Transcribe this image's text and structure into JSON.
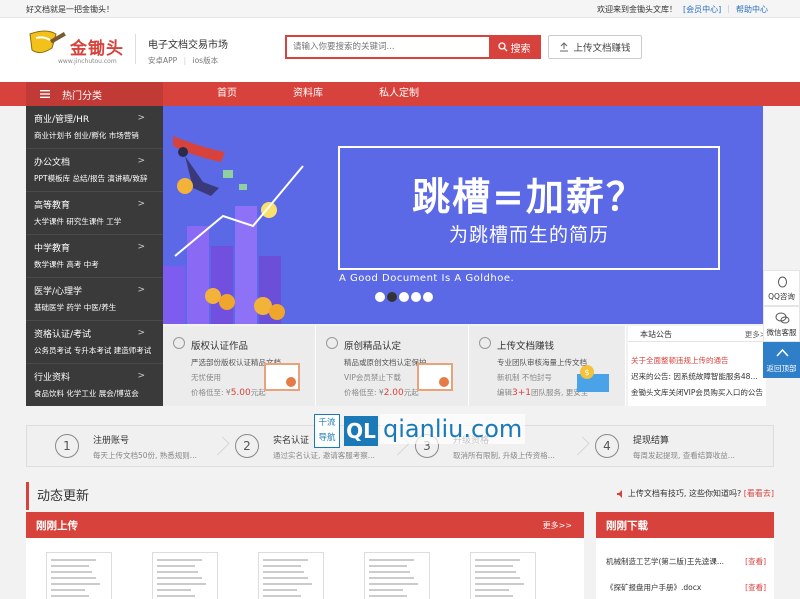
{
  "topbar": {
    "slogan": "好文档就是一把金锄头！",
    "welcome": "欢迎来到金锄头文库！",
    "member_center": "[会员中心]",
    "help_center": "帮助中心"
  },
  "header": {
    "logo_text": "金锄头",
    "logo_url": "www.jinchutou.com",
    "slogan": "电子文档交易市场",
    "apps": [
      "安卓APP",
      "ios版本"
    ],
    "search_placeholder": "请输入你要搜索的关键词...",
    "search_button": "搜索",
    "upload_button": "上传文档赚钱"
  },
  "nav": {
    "category_label": "热门分类",
    "items": [
      "首页",
      "资料库",
      "私人定制"
    ]
  },
  "sidebar": {
    "categories": [
      {
        "title": "商业/管理/HR",
        "sub": "商业计划书  创业/孵化  市场营销"
      },
      {
        "title": "办公文档",
        "sub": "PPT模板库  总结/报告  演讲稿/致辞"
      },
      {
        "title": "高等教育",
        "sub": "大学课件  研究生课件  工学"
      },
      {
        "title": "中学教育",
        "sub": "数学课件  高考  中考"
      },
      {
        "title": "医学/心理学",
        "sub": "基础医学  药学  中医/养生"
      },
      {
        "title": "资格认证/考试",
        "sub": "公务员考试  专升本考试  建造师考试"
      },
      {
        "title": "行业资料",
        "sub": "食品饮料  化学工业  展会/博览会"
      }
    ],
    "arrow": ">"
  },
  "banner": {
    "headline": "跳槽=加薪？",
    "subline": "为跳槽而生的简历",
    "english": "A Good Document Is A Goldhoe.",
    "dots": 5,
    "active_dot": 1
  },
  "features": [
    {
      "title": "版权认证作品",
      "line1": "严选部份版权认证精品文档",
      "line2": "无忧使用",
      "line3_prefix": "价格低至: ¥",
      "price": "5.00",
      "line3_suffix": "元起"
    },
    {
      "title": "原创精品认定",
      "line1": "精品或原创文档认定保护",
      "line2": "VIP会员禁止下载",
      "line3_prefix": "价格低至: ¥",
      "price": "2.00",
      "line3_suffix": "元起"
    },
    {
      "title": "上传文档赚钱",
      "line1": "专业团队审核海量上传文档",
      "line2": "新机制  不怕封号",
      "line3_prefix": "编辑",
      "price": "3+1",
      "line3_suffix": "团队服务, 更安全"
    }
  ],
  "notice": {
    "title": "本站公告",
    "more": "更多>",
    "items": [
      {
        "text": "关于全面整顿违规上传的通告",
        "color": "#d8423c"
      },
      {
        "text": "迟来的公告: 因系统故障智能服务48...",
        "color": "#333333"
      },
      {
        "text": "金锄头文库关闭VIP会员购买入口的公告",
        "color": "#333333"
      }
    ]
  },
  "float": {
    "qq": "QQ咨询",
    "wechat": "微信客服",
    "top": "返回顶部"
  },
  "steps": [
    {
      "num": "1",
      "title": "注册账号",
      "desc": "每天上传文档50份, 熟悉规则..."
    },
    {
      "num": "2",
      "title": "实名认证",
      "desc": "通过实名认证, 邀请客服考察..."
    },
    {
      "num": "3",
      "title": "升级资格",
      "desc": "取消所有限制, 升级上传资格..."
    },
    {
      "num": "4",
      "title": "提现结算",
      "desc": "每周发起提现, 查看结算收益..."
    }
  ],
  "watermark": {
    "cn1": "千流",
    "cn2": "导航",
    "badge": "QL",
    "domain": "qianliu.com"
  },
  "dynamic": {
    "title": "动态更新",
    "tip": "上传文档有技巧, 这些你知道吗?",
    "tip_link": "[看看去]"
  },
  "recent_upload": {
    "title": "刚刚上传",
    "more": "更多>>",
    "doc_count": 5
  },
  "recent_download": {
    "title": "刚刚下载",
    "items": [
      {
        "name": "机械制造工艺学(第二版)王先逵课...",
        "action": "[查看]"
      },
      {
        "name": "《探矿报盘用户手册》.docx",
        "action": "[查看]"
      }
    ]
  },
  "colors": {
    "brand_red": "#d8423c",
    "banner_blue": "#5b69e6",
    "sidebar_dark": "#3a3a3a",
    "float_blue": "#2f7fc8"
  }
}
